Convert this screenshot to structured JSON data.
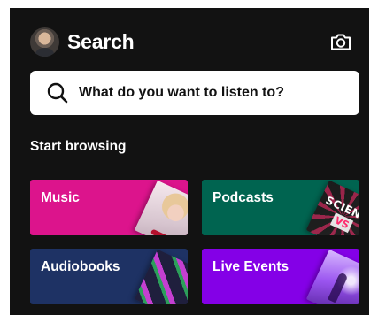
{
  "header": {
    "title": "Search",
    "avatar_icon": "user-avatar",
    "camera_icon": "camera-icon"
  },
  "search": {
    "placeholder": "What do you want to listen to?",
    "icon": "search-icon"
  },
  "browse": {
    "section_title": "Start browsing",
    "tiles": [
      {
        "label": "Music",
        "color": "#DC148C"
      },
      {
        "label": "Podcasts",
        "color": "#006450"
      },
      {
        "label": "Audiobooks",
        "color": "#1E3264"
      },
      {
        "label": "Live Events",
        "color": "#8400E7"
      }
    ]
  },
  "colors": {
    "background": "#121212",
    "text": "#FFFFFF",
    "searchbar": "#FFFFFF"
  }
}
